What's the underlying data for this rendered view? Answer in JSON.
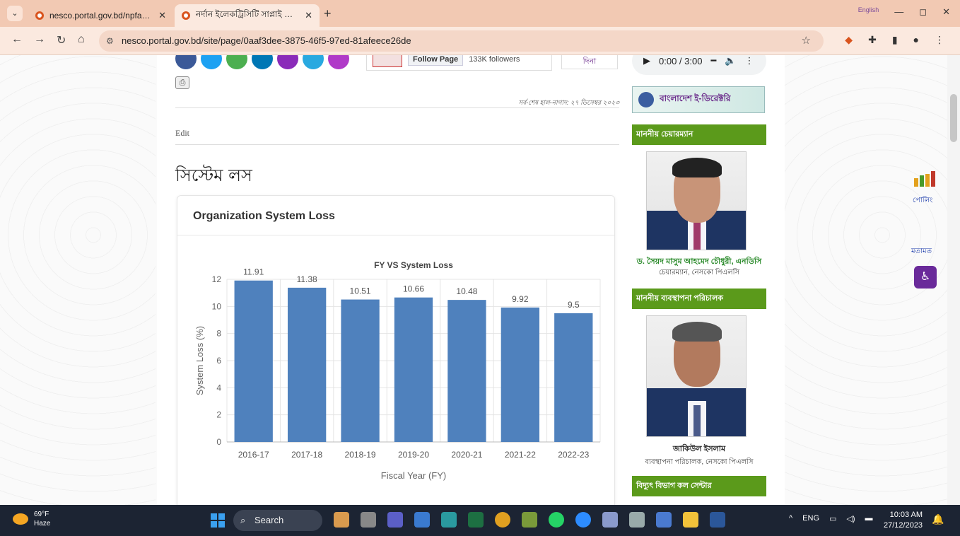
{
  "browser": {
    "tabs": [
      {
        "title": "nesco.portal.gov.bd/npfadmin/",
        "active": false
      },
      {
        "title": "নর্দান ইলেকট্রিসিটি সাপ্লাই কোম্",
        "active": true
      }
    ],
    "url": "nesco.portal.gov.bd/site/page/0aaf3dee-3875-46f5-97ed-81afeece26de",
    "lang_label": "English"
  },
  "page": {
    "fb_follow_label": "Follow Page",
    "fb_followers": "133K followers",
    "date_button": "দিনা",
    "last_updated": "সর্ব-শেষ হাল-নাগাদ: ২৭ ডিসেম্বর ২০২৩",
    "edit_label": "Edit",
    "title": "সিস্টেম লস",
    "card_title": "Organization System Loss"
  },
  "sidebar": {
    "audio_time": "0:00 / 3:00",
    "e_directory": "বাংলাদেশ ই-ডিরেক্টরি",
    "chairman_heading": "মাননীয় চেয়ারম্যান",
    "chairman_name": "ড. সৈয়দ মাসুম আহমেদ চৌধুরী, এনডিসি",
    "chairman_role": "চেয়ারম্যান, নেসকো পিএলসি",
    "md_heading": "মাননীয় ব্যবস্থাপনা পরিচালক",
    "md_name": "জাকিউল ইসলাম",
    "md_role": "ব্যবস্থাপনা পরিচালক, নেসকো পিএলসি",
    "call_center_heading": "বিদ্যুৎ বিভাগ কল সেন্টার",
    "poll_label": "পোলিং",
    "feedback_label": "মতামত"
  },
  "chart_data": {
    "type": "bar",
    "title": "FY VS System Loss",
    "xlabel": "Fiscal Year (FY)",
    "ylabel": "System Loss (%)",
    "categories": [
      "2016-17",
      "2017-18",
      "2018-19",
      "2019-20",
      "2020-21",
      "2021-22",
      "2022-23"
    ],
    "values": [
      11.91,
      11.38,
      10.51,
      10.66,
      10.48,
      9.92,
      9.5
    ],
    "value_labels": [
      "11.91",
      "11.38",
      "10.51",
      "10.66",
      "10.48",
      "9.92",
      "9.5"
    ],
    "ylim": [
      0,
      12
    ],
    "yticks": [
      0,
      2,
      4,
      6,
      8,
      10,
      12
    ],
    "grid": true,
    "bar_color": "#4f81bd"
  },
  "taskbar": {
    "temperature": "69°F",
    "weather": "Haze",
    "search_placeholder": "Search",
    "lang": "ENG",
    "time": "10:03 AM",
    "date": "27/12/2023"
  }
}
